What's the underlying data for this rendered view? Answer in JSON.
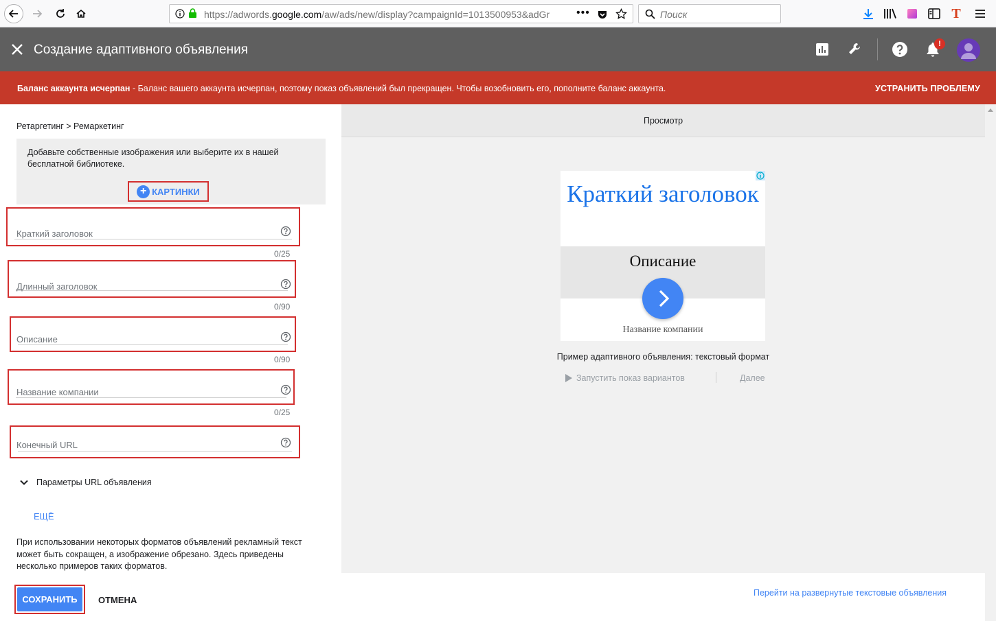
{
  "browser": {
    "url_prefix": "https://adwords.",
    "url_domain": "google.com",
    "url_suffix": "/aw/ads/new/display?campaignId=1013500953&adGr",
    "search_placeholder": "Поиск"
  },
  "header": {
    "title": "Создание адаптивного объявления",
    "notification_badge": "!"
  },
  "alert": {
    "bold": "Баланс аккаунта исчерпан",
    "message": " - Баланс вашего аккаунта исчерпан, поэтому показ объявлений был прекращен. Чтобы возобновить его, пополните баланс аккаунта.",
    "action": "УСТРАНИТЬ ПРОБЛЕМУ"
  },
  "form": {
    "breadcrumb": "Ретаргетинг > Ремаркетинг",
    "images_hint": "Добавьте собственные изображения или выберите их в нашей бесплатной библиотеке.",
    "images_button": "КАРТИНКИ",
    "fields": [
      {
        "placeholder": "Краткий заголовок",
        "counter": "0/25"
      },
      {
        "placeholder": "Длинный заголовок",
        "counter": "0/90"
      },
      {
        "placeholder": "Описание",
        "counter": "0/90"
      },
      {
        "placeholder": "Название компании",
        "counter": "0/25"
      },
      {
        "placeholder": "Конечный URL",
        "counter": ""
      }
    ],
    "url_params": "Параметры URL объявления",
    "more": "ЕЩЁ",
    "note": "При использовании некоторых форматов объявлений рекламный текст может быть сокращен, а изображение обрезано. Здесь приведены несколько примеров таких форматов."
  },
  "preview": {
    "title": "Просмотр",
    "ad_headline": "Краткий заголовок",
    "ad_description": "Описание",
    "ad_company": "Название компании",
    "caption": "Пример адаптивного объявления: текстовый формат",
    "run_variants": "Запустить показ вариантов",
    "next": "Далее"
  },
  "footer": {
    "save": "СОХРАНИТЬ",
    "cancel": "ОТМЕНА",
    "expanded_link": "Перейти на развернутые текстовые объявления"
  },
  "colors": {
    "accent": "#4285f4",
    "alert": "#c53929",
    "header": "#5f5f5f",
    "highlight": "#d32f2f"
  }
}
